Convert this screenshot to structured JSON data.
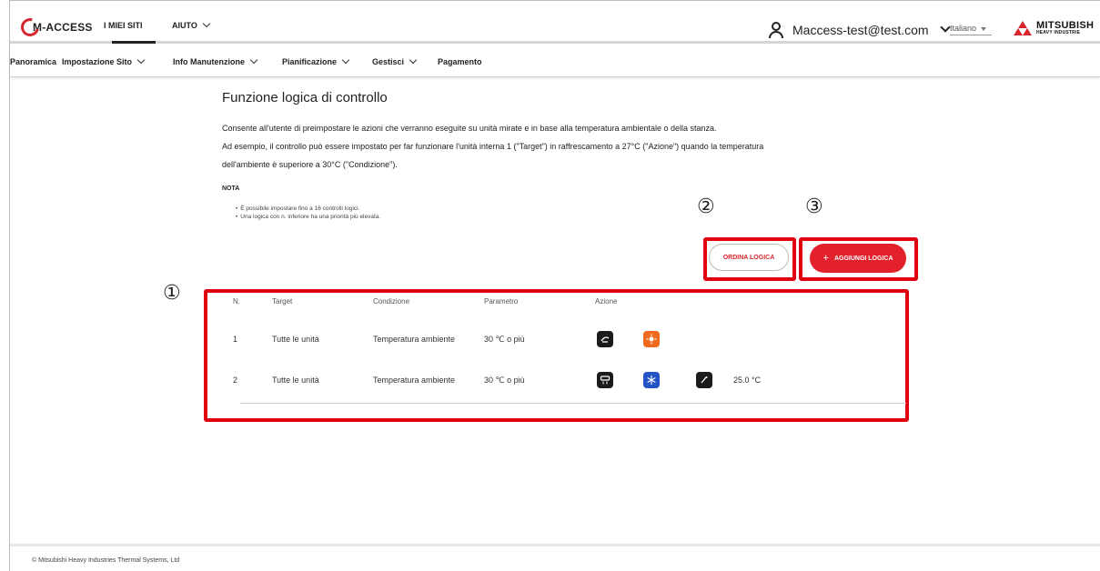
{
  "header": {
    "logo_text": "M-ACCESS",
    "nav": [
      {
        "label": "I MIEI SITI"
      },
      {
        "label": "AIUTO"
      }
    ],
    "user_email": "Maccess-test@test.com",
    "language": "Italiano",
    "brand_line1": "MITSUBISH",
    "brand_line2": "HEAVY INDUSTRIE"
  },
  "subnav": [
    {
      "label": "Panoramica"
    },
    {
      "label": "Impostazione Sito"
    },
    {
      "label": "Info Manutenzione"
    },
    {
      "label": "Pianificazione"
    },
    {
      "label": "Gestisci"
    },
    {
      "label": "Pagamento"
    }
  ],
  "main": {
    "title": "Funzione logica di controllo",
    "desc_line1": "Consente all'utente di preimpostare le azioni che verranno eseguite su unità mirate e in base alla temperatura ambientale o della stanza.",
    "desc_line2": "Ad esempio, il controllo può essere impostato per far funzionare l'unità interna 1 (\"Target\") in raffrescamento a 27°C (\"Azione\") quando la temperatura",
    "desc_line3": "dell'ambiente è superiore a 30°C (\"Condizione\").",
    "nota_label": "NOTA",
    "notes": [
      "È possibile impostare fino a 16 controlli logici.",
      "Una logica con n. inferiore ha una priorità più elevata."
    ],
    "sort_button": "ORDINA LOGICA",
    "add_button": "AGGIUNGI LOGICA",
    "add_button_plus": "+"
  },
  "annotations": {
    "marker1": "①",
    "marker2": "②",
    "marker3": "③",
    "highlight_color": "#e00010"
  },
  "table": {
    "headers": {
      "n": "N.",
      "target": "Target",
      "condition": "Condizione",
      "parameter": "Parametro",
      "action": "Azione"
    },
    "rows": [
      {
        "n": "1",
        "target": "Tutte le unità",
        "condition": "Temperatura ambiente",
        "parameter": "30 ℃ o più",
        "actions": [
          "power-icon",
          "heat-mode-icon"
        ],
        "value": ""
      },
      {
        "n": "2",
        "target": "Tutte le unità",
        "condition": "Temperatura ambiente",
        "parameter": "30 ℃ o più",
        "actions": [
          "ac-unit-icon",
          "cool-mode-icon",
          "set-temperature-icon"
        ],
        "value": "25.0 °C"
      }
    ]
  },
  "colors": {
    "accent": "#e3212c",
    "heat": "#ef6a1c",
    "cool": "#2454c4"
  },
  "footer": {
    "copyright": "© Mitsubishi Heavy Industries Thermal Systems, Ltd"
  }
}
